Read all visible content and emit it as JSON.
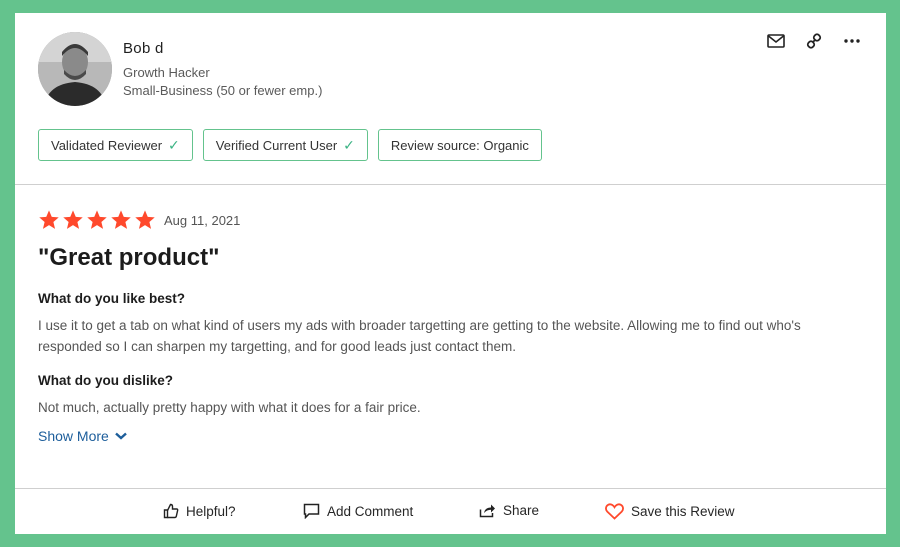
{
  "reviewer": {
    "name": "Bob d",
    "title": "Growth Hacker",
    "segment": "Small-Business (50 or fewer emp.)"
  },
  "header_actions": {
    "icons": [
      "mail-icon",
      "link-icon",
      "more-icon"
    ]
  },
  "badges": [
    {
      "label": "Validated Reviewer",
      "checked": true
    },
    {
      "label": "Verified Current User",
      "checked": true
    },
    {
      "label": "Review source: Organic",
      "checked": false
    }
  ],
  "review": {
    "rating": 5,
    "date": "Aug 11, 2021",
    "title": "\"Great product\"",
    "q1": "What do you like best?",
    "a1": "I use it to get a tab on what kind of users my ads with broader targetting are getting to the website. Allowing me to find out who's responded so I can sharpen my targetting, and for good leads just contact them.",
    "q2": "What do you dislike?",
    "a2": "Not much, actually pretty happy with what it does for a fair price.",
    "show_more": "Show More"
  },
  "footer": {
    "helpful": "Helpful?",
    "add_comment": "Add Comment",
    "share": "Share",
    "save": "Save this Review"
  },
  "colors": {
    "background": "#64c38d",
    "star": "#ff492c",
    "link": "#1d5e9b",
    "badge_border": "#64c38d",
    "check": "#3ab383",
    "heart": "#ff492c"
  }
}
